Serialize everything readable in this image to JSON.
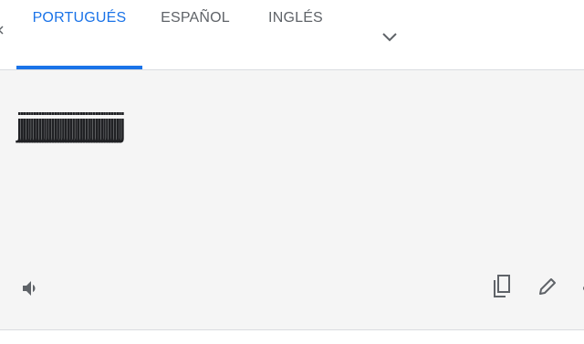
{
  "tabs": [
    {
      "label": "PORTUGUÉS",
      "active": true
    },
    {
      "label": "ESPAÑOL",
      "active": false
    },
    {
      "label": "INGLÉS",
      "active": false
    }
  ],
  "more_languages_icon": "chevron-down-icon",
  "translation": {
    "text": "jjjjjjjjjjjjjjjjjjjjjjjjjjjjjjjjjjjjjjjjj"
  },
  "actions": {
    "listen_icon": "speaker-icon",
    "copy_icon": "copy-icon",
    "edit_icon": "pencil-icon"
  },
  "colors": {
    "accent": "#1a73e8",
    "tab_text": "#5f6368",
    "panel_bg": "#f5f5f5",
    "text": "#202124"
  }
}
